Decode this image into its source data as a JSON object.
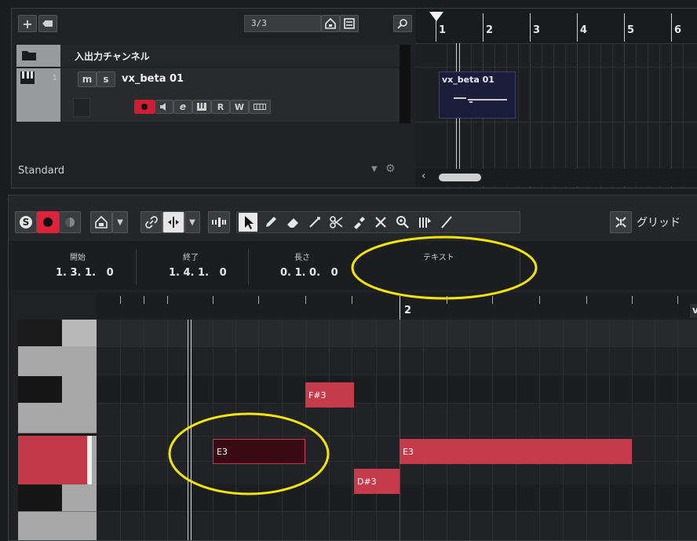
{
  "project": {
    "track_count": "3/3",
    "folder_track_name": "入出力チャンネル",
    "track_number": "1",
    "track_name": "vx_beta 01",
    "mute_label": "m",
    "solo_label": "s",
    "rack_label": "Standard",
    "read_label": "R",
    "write_label": "W"
  },
  "ruler_top": [
    "1",
    "2",
    "3",
    "4",
    "5",
    "6"
  ],
  "event": {
    "name": "vx_beta 01"
  },
  "editor": {
    "snap_type": "グリッド",
    "info_headers": {
      "start": "開始",
      "end": "終了",
      "length": "長さ",
      "text": "テキスト"
    },
    "info_values": {
      "start": "1. 3. 1.   0",
      "end": "1. 4. 1.   0",
      "length": "0. 1. 0.   0",
      "text": ""
    },
    "ruler_bar": "2",
    "ruler_right_label": "v",
    "notes": [
      {
        "label": "F#3",
        "selected": false
      },
      {
        "label": "E3",
        "selected": true
      },
      {
        "label": "E3",
        "selected": false
      },
      {
        "label": "D#3",
        "selected": false
      }
    ]
  },
  "colors": {
    "note": "#c53b4c",
    "note_selected": "#3a0a12",
    "record": "#e0213a",
    "highlight_ellipse": "#f2e600",
    "active_key": "#c23a4a"
  }
}
